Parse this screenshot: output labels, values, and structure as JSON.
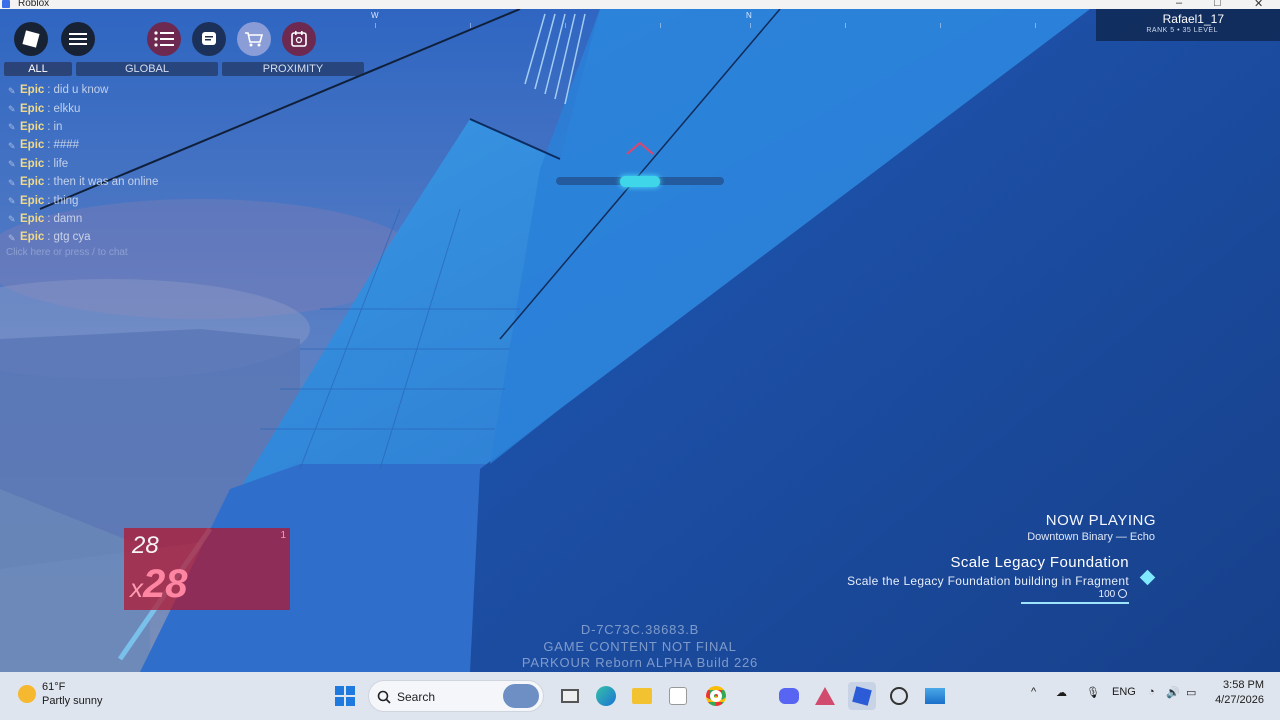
{
  "window": {
    "title": "Roblox",
    "minimize": "–",
    "maximize": "□",
    "close": "✕"
  },
  "top_buttons": [
    {
      "name": "roblox-menu-button",
      "icon": "roblox-logo-icon"
    },
    {
      "name": "hamburger-menu-button",
      "icon": "hamburger-icon"
    },
    {
      "name": "list-button",
      "icon": "list-icon"
    },
    {
      "name": "chat-toggle-button",
      "icon": "chat-bubble-icon"
    },
    {
      "name": "shop-button",
      "icon": "cart-icon"
    },
    {
      "name": "calendar-button",
      "icon": "calendar-icon"
    }
  ],
  "chat": {
    "tabs": [
      "ALL",
      "GLOBAL",
      "PROXIMITY"
    ],
    "active_tab": "ALL",
    "messages": [
      {
        "name": "Epic",
        "text": "did u know"
      },
      {
        "name": "Epic",
        "text": "elkku"
      },
      {
        "name": "Epic",
        "text": "in"
      },
      {
        "name": "Epic",
        "text": "####"
      },
      {
        "name": "Epic",
        "text": "life"
      },
      {
        "name": "Epic",
        "text": "then it was an online"
      },
      {
        "name": "Epic",
        "text": "thing"
      },
      {
        "name": "Epic",
        "text": "damn"
      },
      {
        "name": "Epic",
        "text": "gtg cya"
      }
    ],
    "hint": "Click here or press / to chat"
  },
  "compass": {
    "west": "W",
    "north": "N"
  },
  "player": {
    "name": "Rafael1_17",
    "rank_line": "RANK 5 • 35 LEVEL"
  },
  "stamina": {
    "fraction": 0.24
  },
  "combo": {
    "count": "28",
    "multiplier": "28",
    "multiplier_prefix": "x",
    "index": "1"
  },
  "now_playing": {
    "label": "NOW PLAYING",
    "track": "Downtown Binary — Echo"
  },
  "objective": {
    "title": "Scale Legacy Foundation",
    "description": "Scale the Legacy Foundation building in Fragment",
    "reward": "100",
    "progress": 1.0
  },
  "build_info": {
    "id": "D-7C73C.38683.B",
    "notice": "GAME CONTENT NOT FINAL",
    "version": "PARKOUR Reborn  ALPHA  Build 226"
  },
  "taskbar": {
    "weather_temp": "61°F",
    "weather_desc": "Partly sunny",
    "search_label": "Search",
    "language": "ENG",
    "time": "3:58 PM",
    "date": "4/27/2026"
  }
}
